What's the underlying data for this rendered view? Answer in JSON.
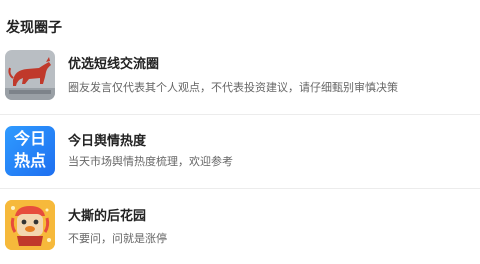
{
  "section": {
    "title": "发现圈子"
  },
  "circles": [
    {
      "name": "优选短线交流圈",
      "description": "圈友发言仅代表其个人观点，不代表投资建议，请仔细甄别审慎决策",
      "icon": "bull-statue-icon"
    },
    {
      "name": "今日舆情热度",
      "description": "当天市场舆情热度梳理，欢迎参考",
      "icon": "hot-topics-icon",
      "icon_text_line1": "今日",
      "icon_text_line2": "热点"
    },
    {
      "name": "大撕的后花园",
      "description": "不要问，问就是涨停",
      "icon": "lion-dance-icon"
    }
  ],
  "colors": {
    "hot_icon_blue": "#1e6ff0",
    "lion_icon_yellow": "#f7c13a",
    "bull_icon_gray": "#b9bec3"
  }
}
